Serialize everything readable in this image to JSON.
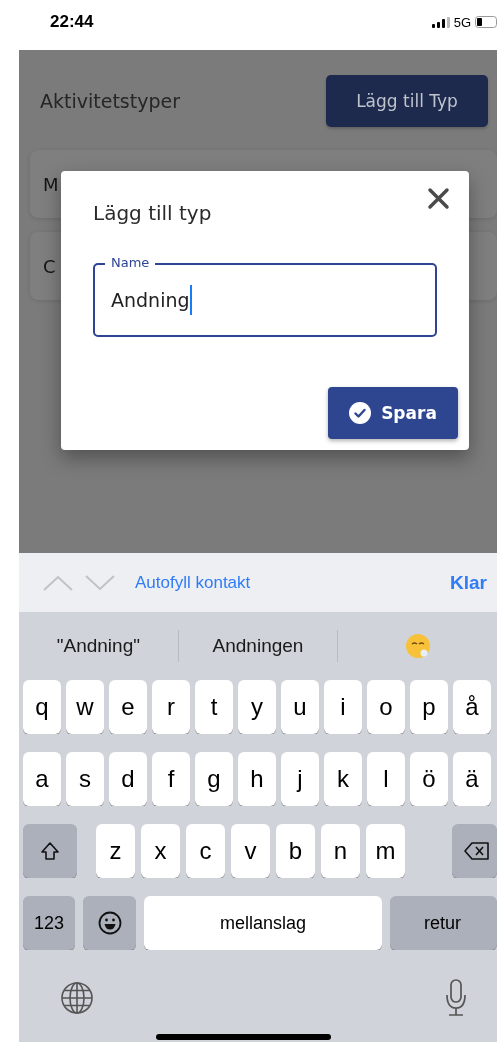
{
  "status_bar": {
    "time": "22:44",
    "network": "5G"
  },
  "page": {
    "title": "Aktivitetstyper",
    "add_button": "Lägg till Typ",
    "items": [
      {
        "label": "M"
      },
      {
        "label": "C"
      }
    ]
  },
  "dialog": {
    "title": "Lägg till typ",
    "field": {
      "label": "Name",
      "value": "Andning",
      "focused": true
    },
    "save_button": "Spara"
  },
  "keyboard": {
    "autofill": "Autofyll kontakt",
    "done": "Klar",
    "suggestions": [
      {
        "kind": "text",
        "label": "\"Andning\""
      },
      {
        "kind": "text",
        "label": "Andningen"
      },
      {
        "kind": "emoji"
      }
    ],
    "rows": [
      {
        "keys": [
          {
            "kind": "letter",
            "label": "q"
          },
          {
            "kind": "letter",
            "label": "w"
          },
          {
            "kind": "letter",
            "label": "e"
          },
          {
            "kind": "letter",
            "label": "r"
          },
          {
            "kind": "letter",
            "label": "t"
          },
          {
            "kind": "letter",
            "label": "y"
          },
          {
            "kind": "letter",
            "label": "u"
          },
          {
            "kind": "letter",
            "label": "i"
          },
          {
            "kind": "letter",
            "label": "o"
          },
          {
            "kind": "letter",
            "label": "p"
          },
          {
            "kind": "letter",
            "label": "å"
          }
        ]
      },
      {
        "keys": [
          {
            "kind": "letter",
            "label": "a"
          },
          {
            "kind": "letter",
            "label": "s"
          },
          {
            "kind": "letter",
            "label": "d"
          },
          {
            "kind": "letter",
            "label": "f"
          },
          {
            "kind": "letter",
            "label": "g"
          },
          {
            "kind": "letter",
            "label": "h"
          },
          {
            "kind": "letter",
            "label": "j"
          },
          {
            "kind": "letter",
            "label": "k"
          },
          {
            "kind": "letter",
            "label": "l"
          },
          {
            "kind": "letter",
            "label": "ö"
          },
          {
            "kind": "letter",
            "label": "ä"
          }
        ]
      },
      {
        "keys": [
          {
            "kind": "shift"
          },
          {
            "kind": "letter",
            "label": "z"
          },
          {
            "kind": "letter",
            "label": "x"
          },
          {
            "kind": "letter",
            "label": "c"
          },
          {
            "kind": "letter",
            "label": "v"
          },
          {
            "kind": "letter",
            "label": "b"
          },
          {
            "kind": "letter",
            "label": "n"
          },
          {
            "kind": "letter",
            "label": "m"
          },
          {
            "kind": "backspace"
          }
        ]
      },
      {
        "keys": [
          {
            "kind": "mode",
            "label": "123"
          },
          {
            "kind": "emoji"
          },
          {
            "kind": "space",
            "label": "mellanslag"
          },
          {
            "kind": "return",
            "label": "retur"
          }
        ]
      }
    ]
  }
}
